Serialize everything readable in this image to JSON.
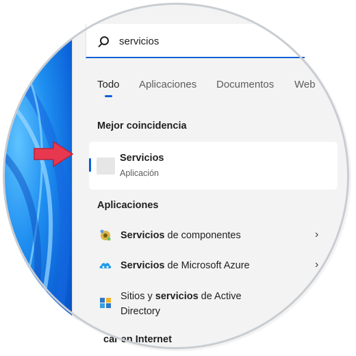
{
  "search": {
    "query": "servicios"
  },
  "tabs": [
    {
      "label": "Todo",
      "active": true
    },
    {
      "label": "Aplicaciones"
    },
    {
      "label": "Documentos"
    },
    {
      "label": "Web"
    }
  ],
  "best_match": {
    "heading": "Mejor coincidencia",
    "title": "Servicios",
    "subtitle": "Aplicación"
  },
  "apps": {
    "heading": "Aplicaciones",
    "items": [
      {
        "bold": "Servicios",
        "rest": " de componentes",
        "icon": "component-services-icon"
      },
      {
        "bold": "Servicios",
        "rest": " de Microsoft Azure",
        "icon": "azure-icon"
      },
      {
        "pre": "Sitios y ",
        "bold": "servicios",
        "rest": " de Active",
        "line2": "Directory",
        "icon": "active-directory-icon"
      }
    ]
  },
  "internet": {
    "heading_partial": "car en Internet"
  },
  "colors": {
    "accent": "#0a5fd6",
    "arrow": "#e8384f",
    "panel": "#f3f3f3"
  }
}
